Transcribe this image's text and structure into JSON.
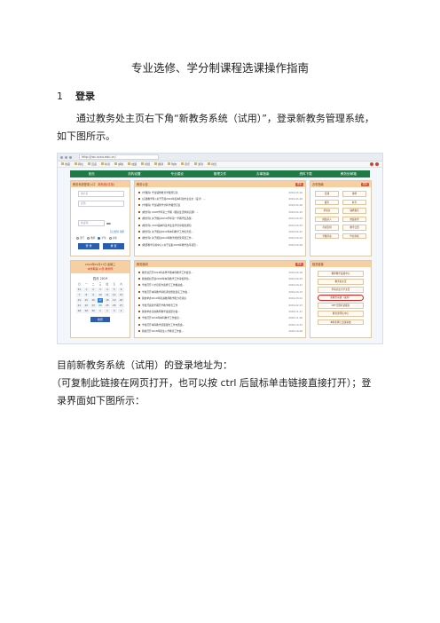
{
  "doc": {
    "title": "专业选修、学分制课程选课操作指南",
    "section1": {
      "number": "1",
      "heading": "登录"
    },
    "para1": "通过教务处主页右下角“新教务系统（试用）”，登录新教务管理系统，如下图所示。",
    "para2": "目前新教务系统（试用）的登录地址为：",
    "para3": "（可复制此链接在网页打开，也可以按 ctrl 后鼠标单击链接直接打开）；登录界面如下图所示："
  },
  "screenshot": {
    "address": "http://jwc.scau.edu.cn/",
    "favorites": [
      "收藏",
      "网址",
      "百度",
      "新闻",
      "邮箱",
      "地图",
      "视频",
      "翻译",
      "购物",
      "音乐",
      "游戏",
      "财经"
    ],
    "nav": [
      "首页",
      "机构设置",
      "专业建设",
      "管理文件",
      "办事指南",
      "资料下载",
      "教务处邮箱"
    ],
    "login": {
      "head": "教务系统登录入口",
      "head_red": "新系统(试用)",
      "user_placeholder": "用户名",
      "pass_placeholder": "密码",
      "code_placeholder": "验证码",
      "code_text": "9N",
      "links": "忘记密码   注册",
      "radios": [
        "部门",
        "教师",
        "学生",
        "访客"
      ],
      "selected_radio": 2,
      "btn_login": "登 录",
      "btn_reset": "重 置"
    },
    "calendar": {
      "line1": "2019年04月17日 星期三",
      "line2": "本学期第 9 周 教学周",
      "month": "四月 2019",
      "weekdays": [
        "日",
        "一",
        "二",
        "三",
        "四",
        "五",
        "六"
      ],
      "days": [
        "31",
        "1",
        "2",
        "3",
        "4",
        "5",
        "6",
        "7",
        "8",
        "9",
        "10",
        "11",
        "12",
        "13",
        "14",
        "15",
        "16",
        "17",
        "18",
        "19",
        "20",
        "21",
        "22",
        "23",
        "24",
        "25",
        "26",
        "27",
        "28",
        "29",
        "30",
        "1",
        "2",
        "3",
        "4"
      ],
      "today": "17",
      "button": "校历"
    },
    "notice": {
      "head": "教务公告",
      "more": "更多",
      "items": [
        {
          "t": "[学籍科] 学生辅修教育学籍登记表",
          "d": "2019-04-16"
        },
        {
          "t": "[实践教学科] 关于开展2019年度本科生毕业论文（设计）...",
          "d": "2019-04-16"
        },
        {
          "t": "[学籍科] 学生辅修学分转学籍登记表",
          "d": "2019-04-16"
        },
        {
          "t": "[教务科] 2018学年第二学期《组织生活体验实践》...",
          "d": "2019-04-15"
        },
        {
          "t": "[教务科] 关于做好2019学年第一学期学生选课...",
          "d": "2019-04-15"
        },
        {
          "t": "[教务科] 2019届本科生毕业生学位审核的通知",
          "d": "2019-04-15"
        },
        {
          "t": "[教务科] 关于组织2019年本科教学工作优秀奖...",
          "d": "2019-04-12"
        },
        {
          "t": "[教务科] 关于组织2019年教学成果奖评选工作...",
          "d": "2019-04-10"
        },
        {
          "t": "[教研教学实验中心] 关于征集2019年教学改革项目...",
          "d": "2019-04-09"
        }
      ]
    },
    "news": {
      "head": "教务新闻",
      "more": "更多",
      "items": [
        {
          "t": "教务处召开2019年春季学期本科教学工作会议...",
          "d": "2019-04-16"
        },
        {
          "t": "我校组织开展2018年本科教学工作审核评估...",
          "d": "2019-04-03"
        },
        {
          "t": "学校召开人才培养方案修订工作推进会...",
          "d": "2019-03-21"
        },
        {
          "t": "学校召开本科教学审核评估整改落实工作会...",
          "d": "2019-03-13"
        },
        {
          "t": "我校举办2019年新进教师教学能力培训班",
          "d": "2019-03-01"
        },
        {
          "t": "学校开展新学期开学教学检查工作",
          "d": "2019-02-27"
        },
        {
          "t": "我校举办高校教师教学发展研讨会...",
          "d": "2018-11-27"
        },
        {
          "t": "学校召开2018年本科教学工作会议...",
          "d": "2018-11-06"
        },
        {
          "t": "学校召开本科教学质量报告工作布置会...",
          "d": "2018-10-31"
        },
        {
          "t": "我校召开2018年新生入学教育工作会...",
          "d": "2018-10-09"
        }
      ]
    },
    "guide": {
      "head": "办事指南",
      "more": "更多",
      "items": [
        "选课",
        "重修",
        "缓考",
        "补考",
        "转专业",
        "辅修报名",
        "成绩录入",
        "成绩复查",
        "考试安排",
        "教学日历",
        "学籍异动",
        "毕业审核"
      ]
    },
    "links": {
      "head": "相关链接",
      "items": [
        "教师教学发展中心",
        "教务处主页",
        "华南农业大学主页",
        "新教务系统（试用）",
        "CET全国考试报名",
        "教育部评估中心",
        "本科生网上选课系统"
      ],
      "circled_index": 3
    }
  }
}
